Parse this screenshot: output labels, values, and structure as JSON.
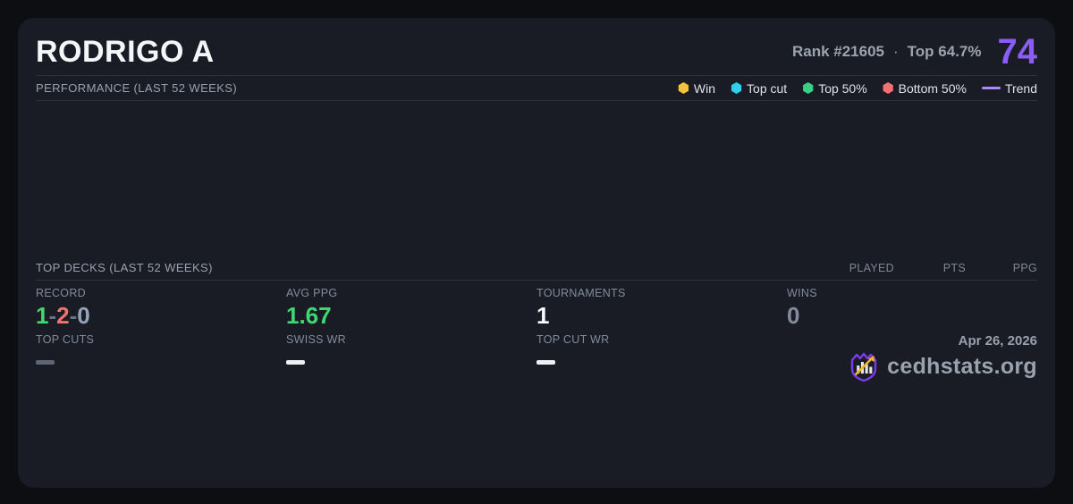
{
  "header": {
    "title": "RODRIGO A",
    "rank": "Rank #21605",
    "separator": "·",
    "top_percent": "Top 64.7%",
    "score": "74",
    "score_color": "#8b5cf6"
  },
  "performance": {
    "label": "PERFORMANCE (LAST 52 WEEKS)",
    "legend": [
      {
        "label": "Win",
        "color": "#f2c33c",
        "type": "dot"
      },
      {
        "label": "Top cut",
        "color": "#2fd0ec",
        "type": "dot"
      },
      {
        "label": "Top 50%",
        "color": "#38d183",
        "type": "dot"
      },
      {
        "label": "Bottom 50%",
        "color": "#f47171",
        "type": "dot"
      },
      {
        "label": "Trend",
        "color": "#a78bfa",
        "type": "line"
      }
    ]
  },
  "top_decks": {
    "label": "TOP DECKS (LAST 52 WEEKS)",
    "columns": [
      "PLAYED",
      "PTS",
      "PPG"
    ]
  },
  "stats": {
    "record": {
      "label": "RECORD",
      "parts": [
        {
          "text": "1",
          "color": "#3fd873"
        },
        {
          "text": "-",
          "color": "#6b7280"
        },
        {
          "text": "2",
          "color": "#f47171"
        },
        {
          "text": "-",
          "color": "#6b7280"
        },
        {
          "text": "0",
          "color": "#94a3b8"
        }
      ]
    },
    "avg_ppg": {
      "label": "AVG PPG",
      "value": "1.67",
      "color": "#3fd873"
    },
    "tournaments": {
      "label": "TOURNAMENTS",
      "value": "1",
      "color": "#f8fafc"
    },
    "wins": {
      "label": "WINS",
      "value": "0",
      "color": "#848b9a"
    },
    "top_cuts": {
      "label": "TOP CUTS",
      "dash_color": "#5d6675"
    },
    "swiss_wr": {
      "label": "SWISS WR",
      "dash_color": "#eef1f4"
    },
    "top_cut_wr": {
      "label": "TOP CUT WR",
      "dash_color": "#eef1f4"
    }
  },
  "footer": {
    "date": "Apr 26, 2026",
    "brand": "cedhstats.org"
  }
}
